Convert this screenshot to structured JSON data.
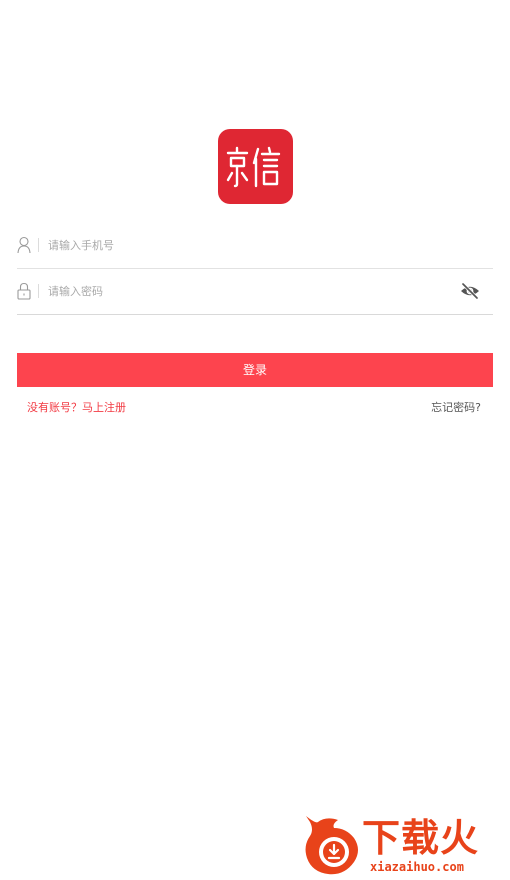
{
  "app": {
    "logo_text": "京信",
    "logo_color": "#df2733"
  },
  "login_form": {
    "phone": {
      "placeholder": "请输入手机号",
      "value": "",
      "icon": "user-icon"
    },
    "password": {
      "placeholder": "请输入密码",
      "value": "",
      "icon": "lock-icon",
      "toggle_icon": "eye-off-icon"
    },
    "submit_label": "登录",
    "submit_color": "#fd444e"
  },
  "links": {
    "register": "没有账号？马上注册",
    "forgot_password": "忘记密码?"
  },
  "watermark": {
    "title": "下载火",
    "url": "xiazaihuo.com",
    "color": "#e8431a"
  }
}
